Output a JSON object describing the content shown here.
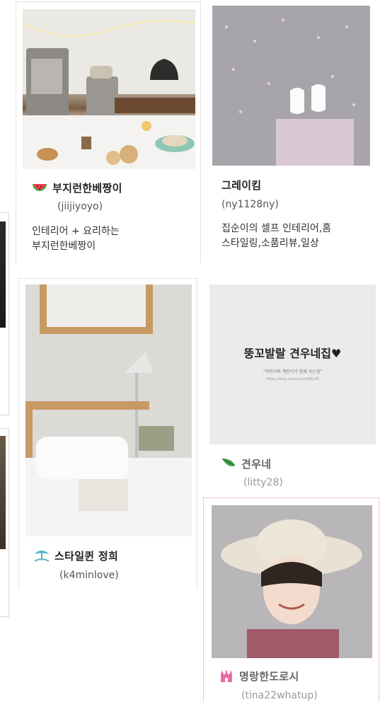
{
  "cards": [
    {
      "nickname": "부지런한베짱이",
      "user_id": "(jiijiyoyo)",
      "desc_line1": "인테리어 + 요리하는",
      "desc_line2": "부지런한베짱이",
      "icon": "watermelon-icon"
    },
    {
      "nickname": "그레이킴",
      "user_id": "(ny1128ny)",
      "desc_line1": "집순이의 셀프 인테리어,홈",
      "desc_line2": "스타일링,소품리뷰,일상"
    },
    {
      "nickname": "스타일퀸 정희",
      "user_id": "(k4minlove)",
      "icon": "palm-tree-icon"
    },
    {
      "nickname": "견우네",
      "user_id": "(litty28)",
      "icon": "leaf-icon",
      "blog_image_title": "뚱꼬발랄 견우네집♥",
      "blog_image_sub": "\"머린이와 계린이가 함께 사는집\"",
      "blog_image_url": "https://blog.naver.com/litty28"
    },
    {
      "nickname": "명랑한도로시",
      "user_id": "(tina22whatup)",
      "icon": "castle-icon"
    }
  ],
  "colors": {
    "card_border": "#e3e3e3",
    "highlight_border": "#f3c6cf"
  }
}
